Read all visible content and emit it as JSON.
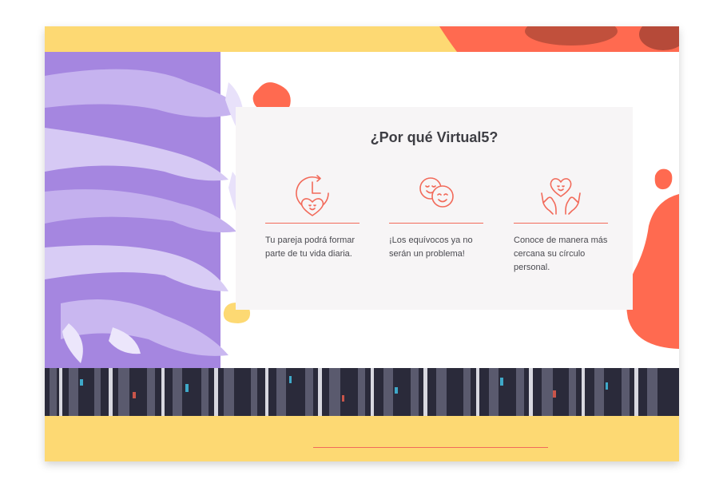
{
  "colors": {
    "yellow": "#fdd973",
    "coral": "#ff6a50",
    "purple": "#a586e0",
    "card_bg": "#f7f5f6",
    "accent_line": "#f26a5a",
    "title_text": "#3e3e44"
  },
  "section": {
    "title": "¿Por qué Virtual5?"
  },
  "features": [
    {
      "icon": "clock-heart-icon",
      "text": "Tu pareja podrá formar parte de tu vida diaria."
    },
    {
      "icon": "smiling-faces-icon",
      "text": "¡Los equívocos ya no serán un problema!"
    },
    {
      "icon": "hands-heart-icon",
      "text": "Conoce de manera más cercana su círculo personal."
    }
  ]
}
